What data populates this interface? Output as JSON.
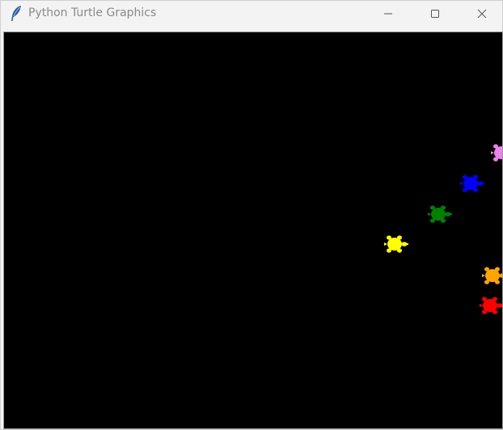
{
  "window": {
    "title": "Python Turtle Graphics",
    "app_icon": "feather-icon",
    "controls": {
      "minimize": "minimize-icon",
      "maximize": "maximize-icon",
      "close": "close-icon"
    }
  },
  "canvas": {
    "background": "#000000",
    "turtles": [
      {
        "name": "violet-turtle",
        "color": "#ee82ee"
      },
      {
        "name": "blue-turtle",
        "color": "#0000ff"
      },
      {
        "name": "green-turtle",
        "color": "#008000"
      },
      {
        "name": "yellow-turtle",
        "color": "#ffff00"
      },
      {
        "name": "orange-turtle",
        "color": "#ffa500"
      },
      {
        "name": "red-turtle",
        "color": "#ff0000"
      }
    ]
  }
}
